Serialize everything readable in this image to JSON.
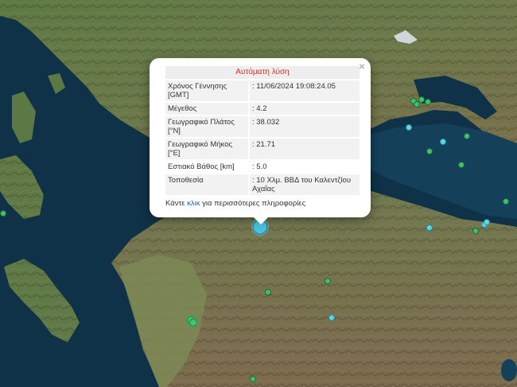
{
  "popup": {
    "title": "Αυτόματη λύση",
    "close_symbol": "×",
    "rows": [
      {
        "label": "Χρόνος Γέννησης [GMT]",
        "value": ": 11/06/2024 19:08:24.05"
      },
      {
        "label": "Μέγεθος",
        "value": ": 4.2"
      },
      {
        "label": "Γεωγραφικό Πλάτος [°N]",
        "value": ": 38.032"
      },
      {
        "label": "Γεωγραφικό Μήκος [°E]",
        "value": ": 21.71"
      },
      {
        "label": "Εστιακό Βάθος [km]",
        "value": ": 5.0"
      },
      {
        "label": "Τοποθεσία",
        "value": ": 10 Χλμ. ΒΒΔ του Καλεντζίου Αχαΐας"
      }
    ],
    "footer_prefix": "Κάντε ",
    "footer_link": "κλικ",
    "footer_suffix": " για περισσότερες πληροφορίες"
  },
  "colors": {
    "sea": "#0f3248",
    "land": "#4f6a3c",
    "title_red": "#d9322b",
    "link_blue": "#1f5fc7",
    "marker_green": "#3fbf6f",
    "marker_cyan": "#5fd6e6"
  }
}
